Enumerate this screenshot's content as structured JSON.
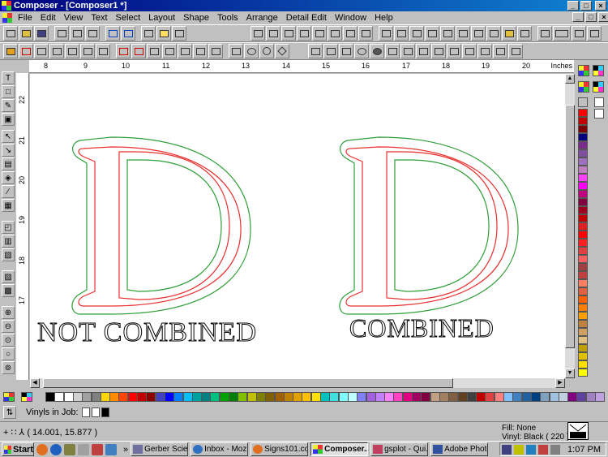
{
  "window": {
    "title": "Composer - [Composer1 *]",
    "minimize": "_",
    "maximize": "□",
    "close": "×"
  },
  "menu": [
    "File",
    "Edit",
    "View",
    "Text",
    "Select",
    "Layout",
    "Shape",
    "Tools",
    "Arrange",
    "Detail Edit",
    "Window",
    "Help"
  ],
  "ruler": {
    "units": "Inches",
    "h_ticks": [
      "8",
      "9",
      "10",
      "11",
      "12",
      "13",
      "14",
      "15",
      "16",
      "17",
      "18",
      "19",
      "20"
    ],
    "v_ticks": [
      "22",
      "21",
      "20",
      "19",
      "18",
      "17"
    ]
  },
  "canvas": {
    "left_caption": "NOT COMBINED",
    "right_caption": "COMBINED",
    "letter": "D",
    "outline_colors": {
      "inner": "#e8302e",
      "outer": "#2e9e36"
    }
  },
  "palette": {
    "right": [
      "#ff0000",
      "#c00000",
      "#7a0000",
      "#000080",
      "#7a2a8a",
      "#8050a0",
      "#a070c0",
      "#c080c0",
      "#ff40ff",
      "#ff00ff",
      "#c00080",
      "#800040",
      "#a00020",
      "#c00000",
      "#e02020",
      "#ff0000",
      "#ff2020",
      "#e04040",
      "#ff6060",
      "#a04040",
      "#c04040",
      "#ff8060",
      "#e06040",
      "#ff6000",
      "#ff8000",
      "#ffa000",
      "#c08040",
      "#d0a060",
      "#e0c080",
      "#c0a000",
      "#e0c000",
      "#ffe000",
      "#ffff00",
      "#ffff80",
      "#c0c0a0",
      "#808060",
      "#a0a080",
      "#606040"
    ],
    "bottom": [
      "#000000",
      "#ffffff",
      "#ffffff",
      "#d0d0d0",
      "#a0a0a0",
      "#808080",
      "#ffd700",
      "#ff8c00",
      "#ff4500",
      "#ff0000",
      "#c00000",
      "#8b0000",
      "#4040c0",
      "#0000ff",
      "#0080ff",
      "#00c0ff",
      "#00a0a0",
      "#008080",
      "#00c080",
      "#00a000",
      "#008000",
      "#80c000",
      "#c0c000",
      "#808000",
      "#806000",
      "#a06000",
      "#c08000",
      "#e0a000",
      "#ffc000",
      "#ffe000",
      "#00c0c0",
      "#40e0e0",
      "#80ffff",
      "#c0ffff",
      "#8080ff",
      "#a060e0",
      "#c080ff",
      "#ff80ff",
      "#ff40c0",
      "#e00080",
      "#a00060",
      "#800040",
      "#c0a080",
      "#a08060",
      "#806040",
      "#604020",
      "#404040",
      "#c00000",
      "#e04040",
      "#ff8080",
      "#80c0ff",
      "#4080c0",
      "#2060a0",
      "#004080",
      "#80a0c0",
      "#a0c0e0",
      "#c0d0e0",
      "#800080",
      "#6040a0",
      "#a080c0",
      "#c0a0e0"
    ]
  },
  "vinyls": {
    "label": "Vinyls in Job:",
    "swatches": [
      "#ffffff",
      "#ffffff",
      "#000000"
    ]
  },
  "status": {
    "coords": "( 14.001, 15.877 )",
    "fill": "Fill: None",
    "vinyl": "Vinyl: Black ( 220 )"
  },
  "taskbar": {
    "start": "Start",
    "more": "»",
    "tasks": [
      "Gerber Scien...",
      "Inbox - Mozill...",
      "Signs101.co...",
      "Composer...",
      "gsplot - Qui...",
      "Adobe Photo..."
    ],
    "active_index": 3,
    "clock": "1:07 PM"
  }
}
